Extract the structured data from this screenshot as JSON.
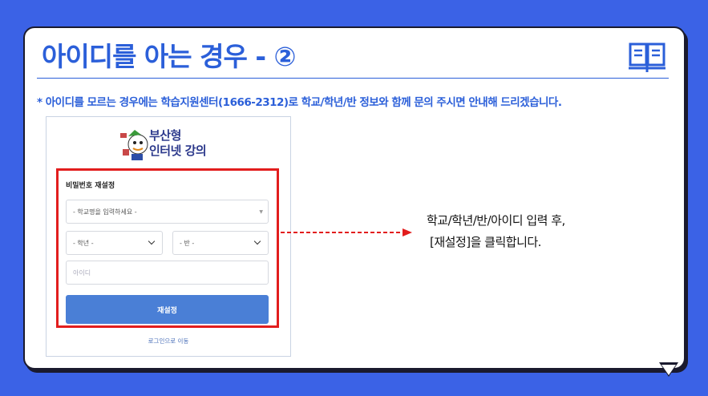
{
  "title": "아이디를 아는 경우 - ②",
  "notice": "* 아이디를 모르는 경우에는 학습지원센터(1666-2312)로 학교/학년/반 정보와 함께 문의 주시면 안내해 드리겠습니다.",
  "logo": {
    "line1": "부산형",
    "line2": "인터넷 강의"
  },
  "form": {
    "heading": "비밀번호 재설정",
    "school_placeholder": "- 학교명을 입력하세요 -",
    "grade_placeholder": "- 학년 -",
    "class_placeholder": "- 반 -",
    "id_placeholder": "아이디",
    "submit_label": "재설정",
    "login_link": "로그인으로 이동"
  },
  "instruction": {
    "line1": "학교/학년/반/아이디 입력 후,",
    "line2": "[재설정]을 클릭합니다."
  },
  "colors": {
    "background": "#3b62e6",
    "accent": "#2b5fd9",
    "highlight": "#e21d1d",
    "button": "#4a7fd6"
  }
}
